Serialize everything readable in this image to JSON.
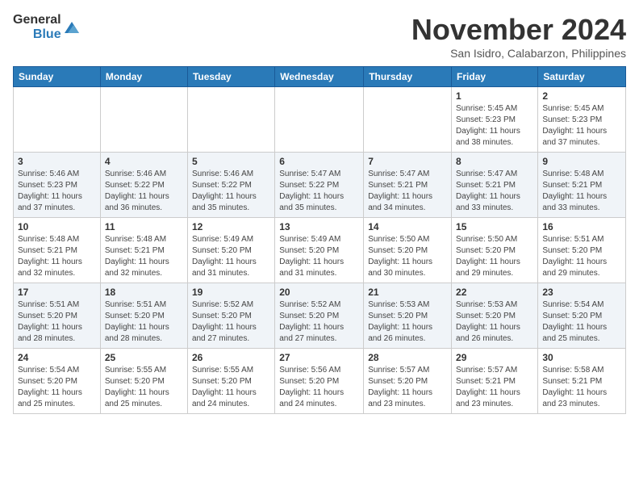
{
  "header": {
    "logo_general": "General",
    "logo_blue": "Blue",
    "month_title": "November 2024",
    "location": "San Isidro, Calabarzon, Philippines"
  },
  "days_of_week": [
    "Sunday",
    "Monday",
    "Tuesday",
    "Wednesday",
    "Thursday",
    "Friday",
    "Saturday"
  ],
  "weeks": [
    [
      {
        "day": "",
        "info": ""
      },
      {
        "day": "",
        "info": ""
      },
      {
        "day": "",
        "info": ""
      },
      {
        "day": "",
        "info": ""
      },
      {
        "day": "",
        "info": ""
      },
      {
        "day": "1",
        "info": "Sunrise: 5:45 AM\nSunset: 5:23 PM\nDaylight: 11 hours\nand 38 minutes."
      },
      {
        "day": "2",
        "info": "Sunrise: 5:45 AM\nSunset: 5:23 PM\nDaylight: 11 hours\nand 37 minutes."
      }
    ],
    [
      {
        "day": "3",
        "info": "Sunrise: 5:46 AM\nSunset: 5:23 PM\nDaylight: 11 hours\nand 37 minutes."
      },
      {
        "day": "4",
        "info": "Sunrise: 5:46 AM\nSunset: 5:22 PM\nDaylight: 11 hours\nand 36 minutes."
      },
      {
        "day": "5",
        "info": "Sunrise: 5:46 AM\nSunset: 5:22 PM\nDaylight: 11 hours\nand 35 minutes."
      },
      {
        "day": "6",
        "info": "Sunrise: 5:47 AM\nSunset: 5:22 PM\nDaylight: 11 hours\nand 35 minutes."
      },
      {
        "day": "7",
        "info": "Sunrise: 5:47 AM\nSunset: 5:21 PM\nDaylight: 11 hours\nand 34 minutes."
      },
      {
        "day": "8",
        "info": "Sunrise: 5:47 AM\nSunset: 5:21 PM\nDaylight: 11 hours\nand 33 minutes."
      },
      {
        "day": "9",
        "info": "Sunrise: 5:48 AM\nSunset: 5:21 PM\nDaylight: 11 hours\nand 33 minutes."
      }
    ],
    [
      {
        "day": "10",
        "info": "Sunrise: 5:48 AM\nSunset: 5:21 PM\nDaylight: 11 hours\nand 32 minutes."
      },
      {
        "day": "11",
        "info": "Sunrise: 5:48 AM\nSunset: 5:21 PM\nDaylight: 11 hours\nand 32 minutes."
      },
      {
        "day": "12",
        "info": "Sunrise: 5:49 AM\nSunset: 5:20 PM\nDaylight: 11 hours\nand 31 minutes."
      },
      {
        "day": "13",
        "info": "Sunrise: 5:49 AM\nSunset: 5:20 PM\nDaylight: 11 hours\nand 31 minutes."
      },
      {
        "day": "14",
        "info": "Sunrise: 5:50 AM\nSunset: 5:20 PM\nDaylight: 11 hours\nand 30 minutes."
      },
      {
        "day": "15",
        "info": "Sunrise: 5:50 AM\nSunset: 5:20 PM\nDaylight: 11 hours\nand 29 minutes."
      },
      {
        "day": "16",
        "info": "Sunrise: 5:51 AM\nSunset: 5:20 PM\nDaylight: 11 hours\nand 29 minutes."
      }
    ],
    [
      {
        "day": "17",
        "info": "Sunrise: 5:51 AM\nSunset: 5:20 PM\nDaylight: 11 hours\nand 28 minutes."
      },
      {
        "day": "18",
        "info": "Sunrise: 5:51 AM\nSunset: 5:20 PM\nDaylight: 11 hours\nand 28 minutes."
      },
      {
        "day": "19",
        "info": "Sunrise: 5:52 AM\nSunset: 5:20 PM\nDaylight: 11 hours\nand 27 minutes."
      },
      {
        "day": "20",
        "info": "Sunrise: 5:52 AM\nSunset: 5:20 PM\nDaylight: 11 hours\nand 27 minutes."
      },
      {
        "day": "21",
        "info": "Sunrise: 5:53 AM\nSunset: 5:20 PM\nDaylight: 11 hours\nand 26 minutes."
      },
      {
        "day": "22",
        "info": "Sunrise: 5:53 AM\nSunset: 5:20 PM\nDaylight: 11 hours\nand 26 minutes."
      },
      {
        "day": "23",
        "info": "Sunrise: 5:54 AM\nSunset: 5:20 PM\nDaylight: 11 hours\nand 25 minutes."
      }
    ],
    [
      {
        "day": "24",
        "info": "Sunrise: 5:54 AM\nSunset: 5:20 PM\nDaylight: 11 hours\nand 25 minutes."
      },
      {
        "day": "25",
        "info": "Sunrise: 5:55 AM\nSunset: 5:20 PM\nDaylight: 11 hours\nand 25 minutes."
      },
      {
        "day": "26",
        "info": "Sunrise: 5:55 AM\nSunset: 5:20 PM\nDaylight: 11 hours\nand 24 minutes."
      },
      {
        "day": "27",
        "info": "Sunrise: 5:56 AM\nSunset: 5:20 PM\nDaylight: 11 hours\nand 24 minutes."
      },
      {
        "day": "28",
        "info": "Sunrise: 5:57 AM\nSunset: 5:20 PM\nDaylight: 11 hours\nand 23 minutes."
      },
      {
        "day": "29",
        "info": "Sunrise: 5:57 AM\nSunset: 5:21 PM\nDaylight: 11 hours\nand 23 minutes."
      },
      {
        "day": "30",
        "info": "Sunrise: 5:58 AM\nSunset: 5:21 PM\nDaylight: 11 hours\nand 23 minutes."
      }
    ]
  ]
}
